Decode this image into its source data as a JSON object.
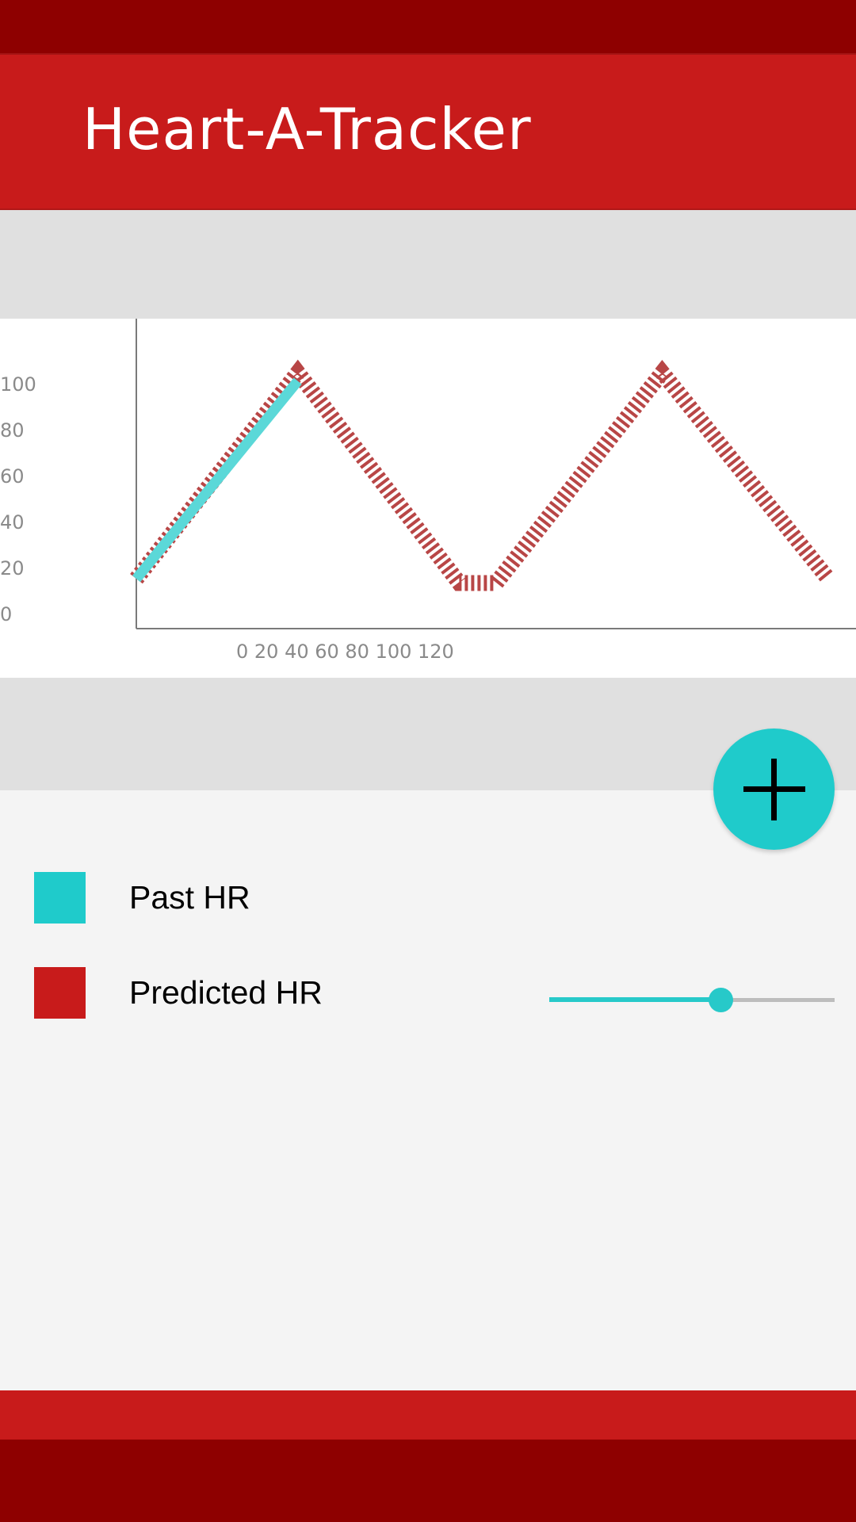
{
  "app": {
    "title": "Heart-A-Tracker"
  },
  "colors": {
    "status_bar": "#8e0000",
    "app_bar": "#c81b1b",
    "accent": "#1fcbcb",
    "past_series": "#5bd8d8",
    "predicted_series": "#b84646"
  },
  "chart_data": {
    "type": "line",
    "y_ticks": [
      "0",
      "20",
      "40",
      "60",
      "80",
      "100"
    ],
    "x_ticks_text": "0 20 40 60 80 100 120",
    "series": [
      {
        "name": "Past HR",
        "style": "solid-thick",
        "points": [
          [
            0,
            12
          ],
          [
            35,
            106
          ]
        ]
      },
      {
        "name": "Predicted HR",
        "style": "hatched",
        "points": [
          [
            0,
            12
          ],
          [
            35,
            110
          ],
          [
            70,
            10
          ],
          [
            78,
            10
          ],
          [
            114,
            110
          ],
          [
            150,
            12
          ]
        ]
      }
    ],
    "x_range": [
      0,
      150
    ],
    "y_range": [
      0,
      110
    ]
  },
  "fab": {
    "icon": "plus-icon"
  },
  "legend": {
    "items": [
      {
        "label": "Past HR",
        "color": "#1fcbcb"
      },
      {
        "label": "Predicted HR",
        "color": "#c81b1b"
      }
    ]
  },
  "slider": {
    "value": 0.6
  }
}
